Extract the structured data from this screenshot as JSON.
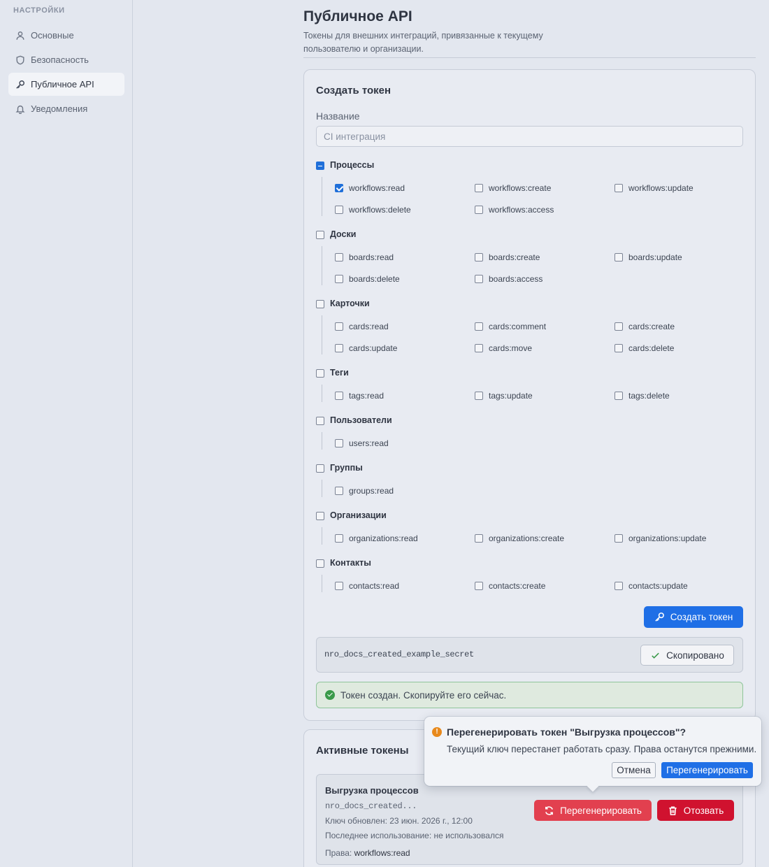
{
  "sidebar": {
    "heading": "НАСТРОЙКИ",
    "items": [
      {
        "label": "Основные",
        "icon": "user-icon"
      },
      {
        "label": "Безопасность",
        "icon": "shield-icon"
      },
      {
        "label": "Публичное API",
        "icon": "key-icon",
        "active": true
      },
      {
        "label": "Уведомления",
        "icon": "bell-icon"
      }
    ]
  },
  "page": {
    "title": "Публичное API",
    "description": "Токены для внешних интеграций, привязанные к текущему пользователю и организации."
  },
  "create": {
    "title": "Создать токен",
    "name_label": "Название",
    "name_placeholder": "CI интеграция",
    "name_value": "",
    "groups": [
      {
        "label": "Процессы",
        "state": "indeterminate",
        "perms": [
          {
            "label": "workflows:read",
            "checked": true
          },
          {
            "label": "workflows:create",
            "checked": false
          },
          {
            "label": "workflows:update",
            "checked": false
          },
          {
            "label": "workflows:delete",
            "checked": false
          },
          {
            "label": "workflows:access",
            "checked": false
          }
        ]
      },
      {
        "label": "Доски",
        "state": "unchecked",
        "perms": [
          {
            "label": "boards:read",
            "checked": false
          },
          {
            "label": "boards:create",
            "checked": false
          },
          {
            "label": "boards:update",
            "checked": false
          },
          {
            "label": "boards:delete",
            "checked": false
          },
          {
            "label": "boards:access",
            "checked": false
          }
        ]
      },
      {
        "label": "Карточки",
        "state": "unchecked",
        "perms": [
          {
            "label": "cards:read",
            "checked": false
          },
          {
            "label": "cards:comment",
            "checked": false
          },
          {
            "label": "cards:create",
            "checked": false
          },
          {
            "label": "cards:update",
            "checked": false
          },
          {
            "label": "cards:move",
            "checked": false
          },
          {
            "label": "cards:delete",
            "checked": false
          }
        ]
      },
      {
        "label": "Теги",
        "state": "unchecked",
        "perms": [
          {
            "label": "tags:read",
            "checked": false
          },
          {
            "label": "tags:update",
            "checked": false
          },
          {
            "label": "tags:delete",
            "checked": false
          }
        ]
      },
      {
        "label": "Пользователи",
        "state": "unchecked",
        "perms": [
          {
            "label": "users:read",
            "checked": false
          }
        ]
      },
      {
        "label": "Группы",
        "state": "unchecked",
        "perms": [
          {
            "label": "groups:read",
            "checked": false
          }
        ]
      },
      {
        "label": "Организации",
        "state": "unchecked",
        "perms": [
          {
            "label": "organizations:read",
            "checked": false
          },
          {
            "label": "organizations:create",
            "checked": false
          },
          {
            "label": "organizations:update",
            "checked": false
          }
        ]
      },
      {
        "label": "Контакты",
        "state": "unchecked",
        "perms": [
          {
            "label": "contacts:read",
            "checked": false
          },
          {
            "label": "contacts:create",
            "checked": false
          },
          {
            "label": "contacts:update",
            "checked": false
          }
        ]
      }
    ],
    "submit_label": "Создать токен",
    "secret": "nro_docs_created_example_secret",
    "copied_label": "Скопировано",
    "success_message": "Токен создан. Скопируйте его сейчас."
  },
  "active": {
    "title": "Активные токены",
    "token": {
      "name": "Выгрузка процессов",
      "prefix": "nro_docs_created...",
      "updated": "Ключ обновлен: 23 июн. 2026 г., 12:00",
      "last_used": "Последнее использование: не использовался",
      "perms_label": "Права:",
      "perms_value": "workflows:read",
      "regenerate_label": "Перегенерировать",
      "revoke_label": "Отозвать"
    }
  },
  "popover": {
    "title": "Перегенерировать токен \"Выгрузка процессов\"?",
    "text": "Текущий ключ перестанет работать сразу. Права останутся прежними.",
    "cancel_label": "Отмена",
    "confirm_label": "Перегенерировать"
  },
  "colors": {
    "accent": "#1f6fe6",
    "danger": "#d0122f",
    "danger_light": "#e2404f",
    "success": "#3a9a4a",
    "warning": "#e8891c"
  }
}
